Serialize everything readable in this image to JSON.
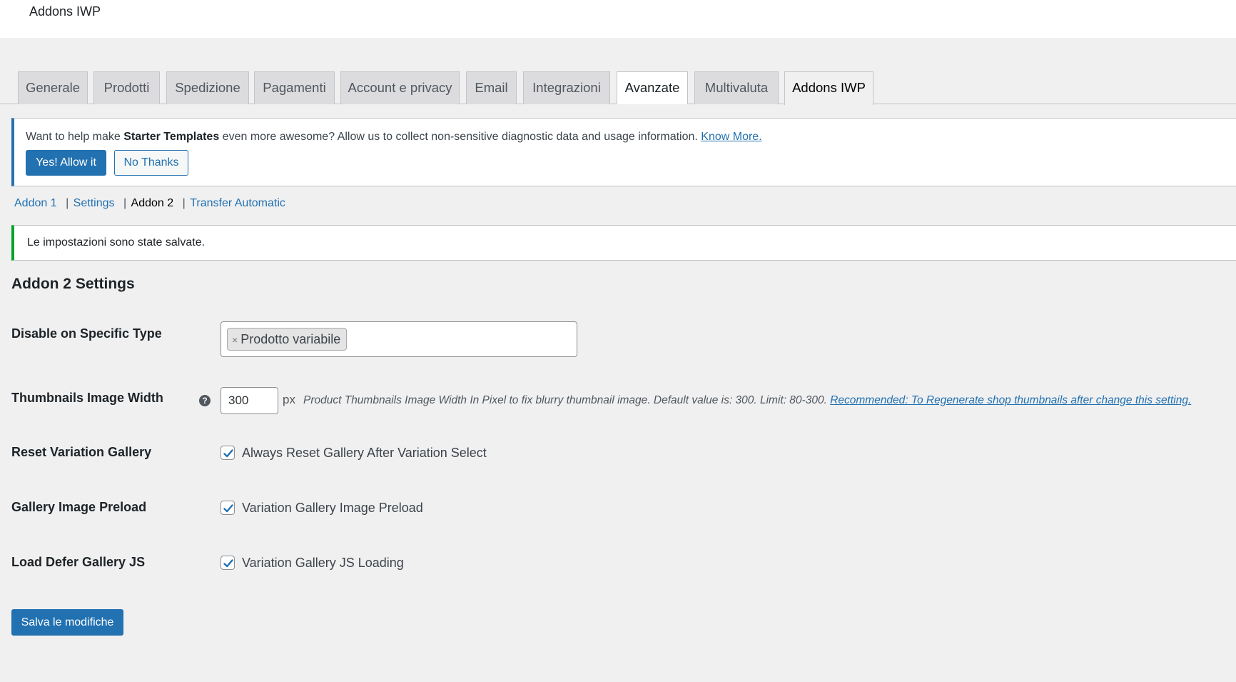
{
  "header": {
    "title": "Addons IWP"
  },
  "tabs": [
    {
      "label": "Generale"
    },
    {
      "label": "Prodotti"
    },
    {
      "label": "Spedizione"
    },
    {
      "label": "Pagamenti"
    },
    {
      "label": "Account e privacy"
    },
    {
      "label": "Email"
    },
    {
      "label": "Integrazioni"
    },
    {
      "label": "Avanzate"
    },
    {
      "label": "Multivaluta"
    },
    {
      "label": "Addons IWP"
    }
  ],
  "notice": {
    "prefix": "Want to help make ",
    "brand": "Starter Templates",
    "suffix": " even more awesome? Allow us to collect non-sensitive diagnostic data and usage information. ",
    "link": "Know More.",
    "allow_button": "Yes! Allow it",
    "decline_button": "No Thanks"
  },
  "subnav": {
    "items": [
      "Addon 1",
      "Settings",
      "Addon 2",
      "Transfer Automatic"
    ],
    "separator": "|"
  },
  "saved_notice": "Le impostazioni sono state salvate.",
  "section_title": "Addon 2 Settings",
  "fields": {
    "disable_type": {
      "label": "Disable on Specific Type",
      "chip_remove": "×",
      "chip_value": "Prodotto variabile"
    },
    "thumb_width": {
      "label": "Thumbnails Image Width",
      "help": "?",
      "value": "300",
      "unit": "px",
      "description": "Product Thumbnails Image Width In Pixel to fix blurry thumbnail image. Default value is: 300. Limit: 80-300. ",
      "description_link": "Recommended: To Regenerate shop thumbnails after change this setting."
    },
    "reset_gallery": {
      "label": "Reset Variation Gallery",
      "checkbox_label": "Always Reset Gallery After Variation Select",
      "checked": true
    },
    "image_preload": {
      "label": "Gallery Image Preload",
      "checkbox_label": "Variation Gallery Image Preload",
      "checked": true
    },
    "defer_js": {
      "label": "Load Defer Gallery JS",
      "checkbox_label": "Variation Gallery JS Loading",
      "checked": true
    }
  },
  "save_button": "Salva le modifiche",
  "colors": {
    "primary": "#2271b1",
    "success": "#00a32a",
    "background": "#f0f0f1"
  }
}
